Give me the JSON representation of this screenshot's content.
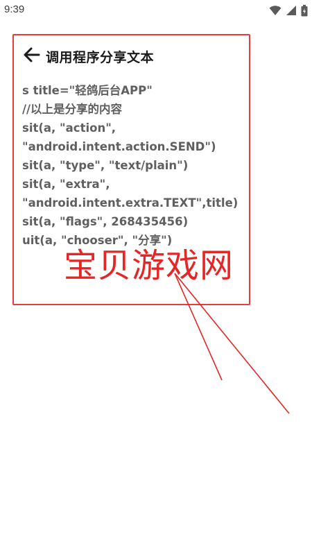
{
  "status_bar": {
    "time": "9:39",
    "icons": [
      "wifi-icon",
      "cell-signal-icon",
      "battery-icon"
    ]
  },
  "panel": {
    "back_icon": "arrow-left-icon",
    "title": "调用程序分享文本",
    "code_lines": [
      "s title=\"轻鸽后台APP\"",
      "//以上是分享的内容",
      "sit(a, \"action\",",
      "\"android.intent.action.SEND\")",
      "sit(a, \"type\", \"text/plain\")",
      "sit(a, \"extra\",",
      "\"android.intent.extra.TEXT\",title)",
      "sit(a, \"flags\", 268435456)",
      "uit(a, \"chooser\", \"分享\")"
    ]
  },
  "watermark": {
    "text": "宝贝游戏网"
  },
  "colors": {
    "frame_red": "#e63c3c",
    "watermark_red": "#e62626",
    "code_gray": "#5f5f5f",
    "title_black": "#1a1a1a"
  }
}
